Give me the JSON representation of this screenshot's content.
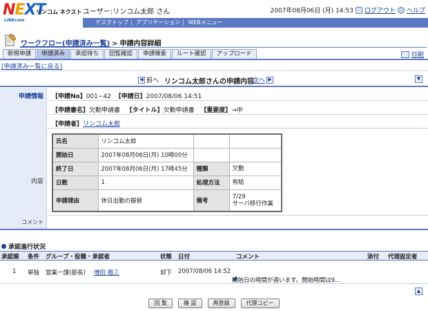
{
  "header": {
    "logo_text": "NEXT",
    "logo_sub": "LiNKcom",
    "logo_name": "リンコム ネクスト",
    "user_label": "ユーザー:リンコム太郎 さん",
    "datetime": "2007年08月06日 (月) 14:53",
    "logout": "ログアウト",
    "help": "ヘルプ"
  },
  "subnav": [
    "デスクトップ",
    "アプリケーション",
    "WEBメニュー"
  ],
  "breadcrumb": {
    "parent": "ワークフロー(申請済み一覧)",
    "current": "申請内容詳細"
  },
  "tabs": [
    {
      "label": "新規申請",
      "active": false
    },
    {
      "label": "申請済み",
      "active": true
    },
    {
      "label": "承認待ち",
      "active": false
    },
    {
      "label": "回覧確認",
      "active": false
    },
    {
      "label": "申請検索",
      "active": false
    },
    {
      "label": "ルート確認",
      "active": false
    },
    {
      "label": "アップロード",
      "active": false
    }
  ],
  "print_label": "印刷",
  "back_link": "[申請済み一覧に戻る]",
  "nav": {
    "prev": "前へ",
    "title": "リンコム太郎さんの申請内容",
    "next": "次へ"
  },
  "detail": {
    "section_info": "申請情報",
    "section_content": "内容",
    "section_comment": "コメント",
    "no_label": "【申請No】",
    "no_value": "001−42",
    "date_label": "【申請日】",
    "date_value": "2007/08/06 14:51",
    "docname_label": "【申請書名】",
    "docname_value": "欠勤申請書",
    "title_label": "【タイトル】",
    "title_value": "欠勤申請書",
    "priority_label": "【重要度】",
    "priority_value": "→中",
    "applicant_label": "【申請者】",
    "applicant_value": "リンコム太郎"
  },
  "content_table": {
    "name_key": "氏名",
    "name_val": "リンコム太郎",
    "start_key": "開始日",
    "start_val": "2007年08月06日(月) 10時00分",
    "end_key": "終了日",
    "end_val": "2007年08月06日(月) 17時45分",
    "type_key": "種類",
    "type_val": "欠勤",
    "days_key": "日数",
    "days_val": "1",
    "method_key": "処理方法",
    "method_val": "有給",
    "reason_key": "申請理由",
    "reason_val": "休日出勤の振替",
    "remarks_key": "備考",
    "remarks_val_1": "7/29",
    "remarks_val_2": "サーバ移行作業"
  },
  "approval": {
    "title": "承認進行状況",
    "headers": {
      "order": "承認順",
      "condition": "条件",
      "group": "グループ・役職・承認者",
      "status": "状態",
      "date": "日付",
      "comment": "コメント",
      "attach": "添付",
      "proxy": "代理設定者"
    },
    "row": {
      "order": "1",
      "condition": "単独",
      "group": "営業一課(部長)",
      "approver": "増田 雅三",
      "status": "却下",
      "date": "2007/08/06 14:52",
      "comment": "開始日の時間が違います。開始時間は9…"
    }
  },
  "buttons": {
    "circulate": "回 覧",
    "confirm": "確 認",
    "reregister": "再登録",
    "proxy_copy": "代理コピー"
  }
}
